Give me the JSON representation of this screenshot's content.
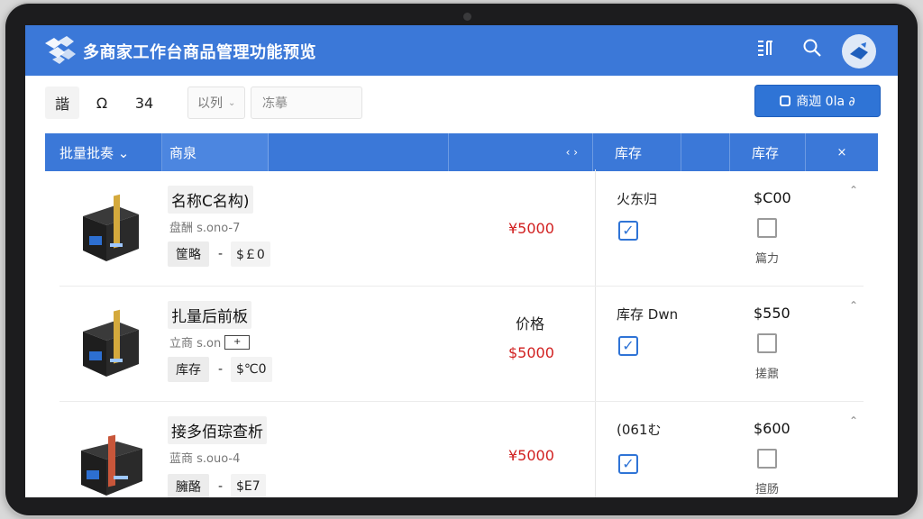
{
  "app": {
    "title": "多商家工作台商品管理功能预览"
  },
  "header": {
    "icons": [
      "grid-icon",
      "search-icon",
      "avatar"
    ]
  },
  "toolbar": {
    "btn1": "諧",
    "btn2": "Ω",
    "btn3": "34",
    "select_value": "以列",
    "search_placeholder": "冻摹",
    "primary_label": "商迦 0la ∂"
  },
  "table": {
    "columns": [
      "批量批奏 ⌄",
      "商泉",
      "‹ ›",
      "库存",
      "库存",
      "×"
    ],
    "rows": [
      {
        "name": "名称C名构)",
        "sku": "盘酬 s.ono-7",
        "tag": "筐略",
        "dash": "-",
        "tag2": "$￡0",
        "label": "",
        "price": "¥5000",
        "stock_text": "火东归",
        "amount": "$C00",
        "note": "篇力"
      },
      {
        "name": "扎量后前板",
        "sku": "立商 s.on",
        "tag": "库存",
        "dash": "-",
        "tag2": "$℃0",
        "label": "价格",
        "price": "$5000",
        "stock_text": "库存 Dwn",
        "amount": "$550",
        "note": "搓鼐"
      },
      {
        "name": "接多佰琮查析",
        "sku": "蓝商 s.ouo-4",
        "tag": "臃酪",
        "dash": "-",
        "tag2": "$E7",
        "label": "",
        "price": "¥5000",
        "stock_text": "(061む",
        "amount": "$600",
        "note": "揎肠"
      }
    ]
  },
  "colors": {
    "primary": "#3b78d8",
    "price": "#d11f1f"
  }
}
